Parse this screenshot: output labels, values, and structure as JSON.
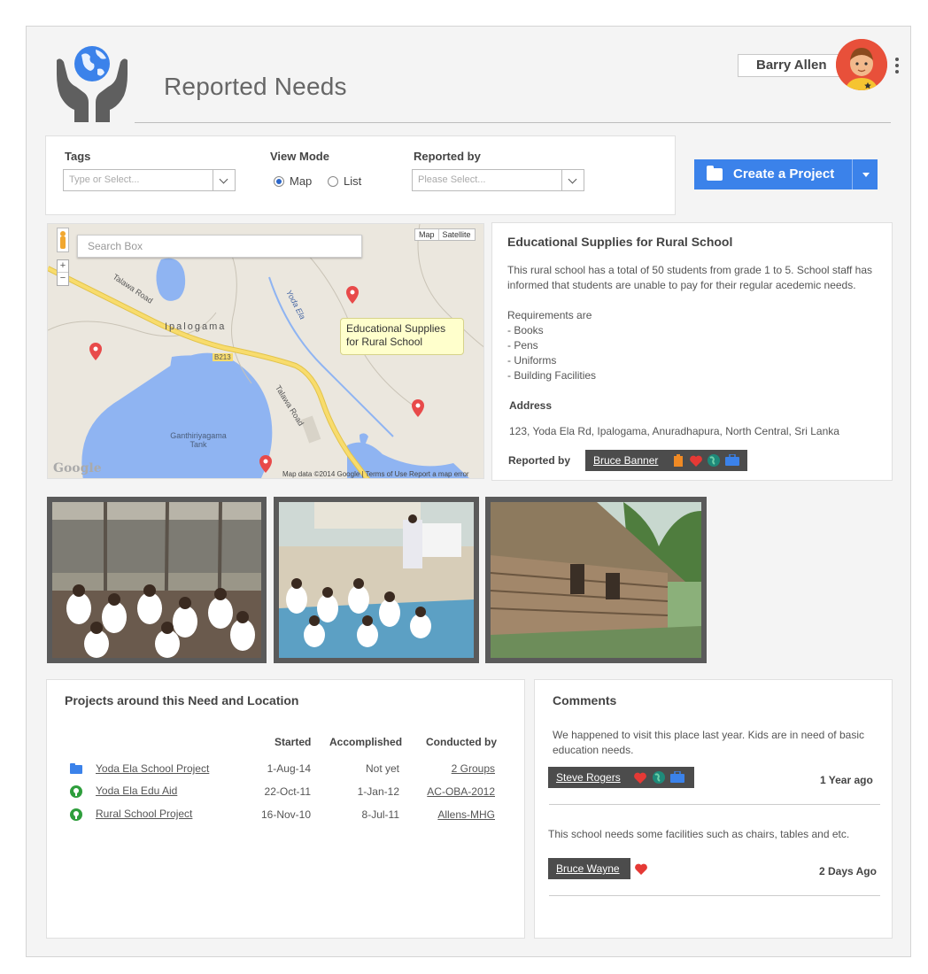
{
  "header": {
    "title": "Reported Needs",
    "user_name": "Barry Allen"
  },
  "filters": {
    "tags_label": "Tags",
    "tags_placeholder": "Type or Select...",
    "view_mode_label": "View Mode",
    "view_mode_options": [
      "Map",
      "List"
    ],
    "view_mode_selected": "Map",
    "reported_by_label": "Reported by",
    "reported_by_placeholder": "Please Select..."
  },
  "actions": {
    "create_project_label": "Create a Project"
  },
  "map": {
    "search_placeholder": "Search Box",
    "type_options": [
      "Map",
      "Satellite"
    ],
    "zoom_in": "+",
    "zoom_out": "−",
    "tooltip": "Educational Supplies for Rural School",
    "labels": {
      "village": "Ipalogama",
      "road1": "Talawa Road",
      "road2": "Talawa Road",
      "river": "Yoda Ela",
      "highway": "B213",
      "tank": "Ganthiriyagama Tank"
    },
    "attribution": "Map data ©2014 Google | Terms of Use   Report a map error",
    "logo_text": "Google"
  },
  "need": {
    "title": "Educational Supplies for Rural School",
    "description": "This rural school has a total of 50 students from grade 1 to 5. School staff has informed that students are unable to pay for their regular acedemic needs.",
    "requirements_intro": "Requirements are",
    "requirements": [
      "- Books",
      "- Pens",
      "- Uniforms",
      "- Building Facilities"
    ],
    "address_label": "Address",
    "address": "123, Yoda Ela Rd, Ipalogama, Anuradhapura, North Central, Sri Lanka",
    "reported_by_label": "Reported by",
    "reported_by": "Bruce Banner"
  },
  "projects": {
    "title": "Projects around this Need and Location",
    "columns": [
      "Started",
      "Accomplished",
      "Conducted by"
    ],
    "rows": [
      {
        "name": "Yoda Ela School Project",
        "started": "1-Aug-14",
        "accomplished": "Not yet",
        "conducted_by": "2 Groups",
        "icon": "folder-icon"
      },
      {
        "name": "Yoda Ela Edu Aid",
        "started": "22-Oct-11",
        "accomplished": "1-Jan-12",
        "conducted_by": "AC-OBA-2012",
        "icon": "tree-badge-icon"
      },
      {
        "name": "Rural School Project",
        "started": "16-Nov-10",
        "accomplished": "8-Jul-11",
        "conducted_by": "Allens-MHG",
        "icon": "tree-badge-icon"
      }
    ]
  },
  "comments": {
    "title": "Comments",
    "items": [
      {
        "text": "We happened to visit this place last year. Kids are in need of basic education needs.",
        "author": "Steve Rogers",
        "time": "1 Year ago"
      },
      {
        "text": "This school needs some facilities such as chairs, tables and etc.",
        "author": "Bruce Wayne",
        "time": "2 Days Ago"
      }
    ]
  },
  "colors": {
    "accent": "#3b82ea",
    "heart": "#e53935",
    "pin": "#e84a4a"
  }
}
